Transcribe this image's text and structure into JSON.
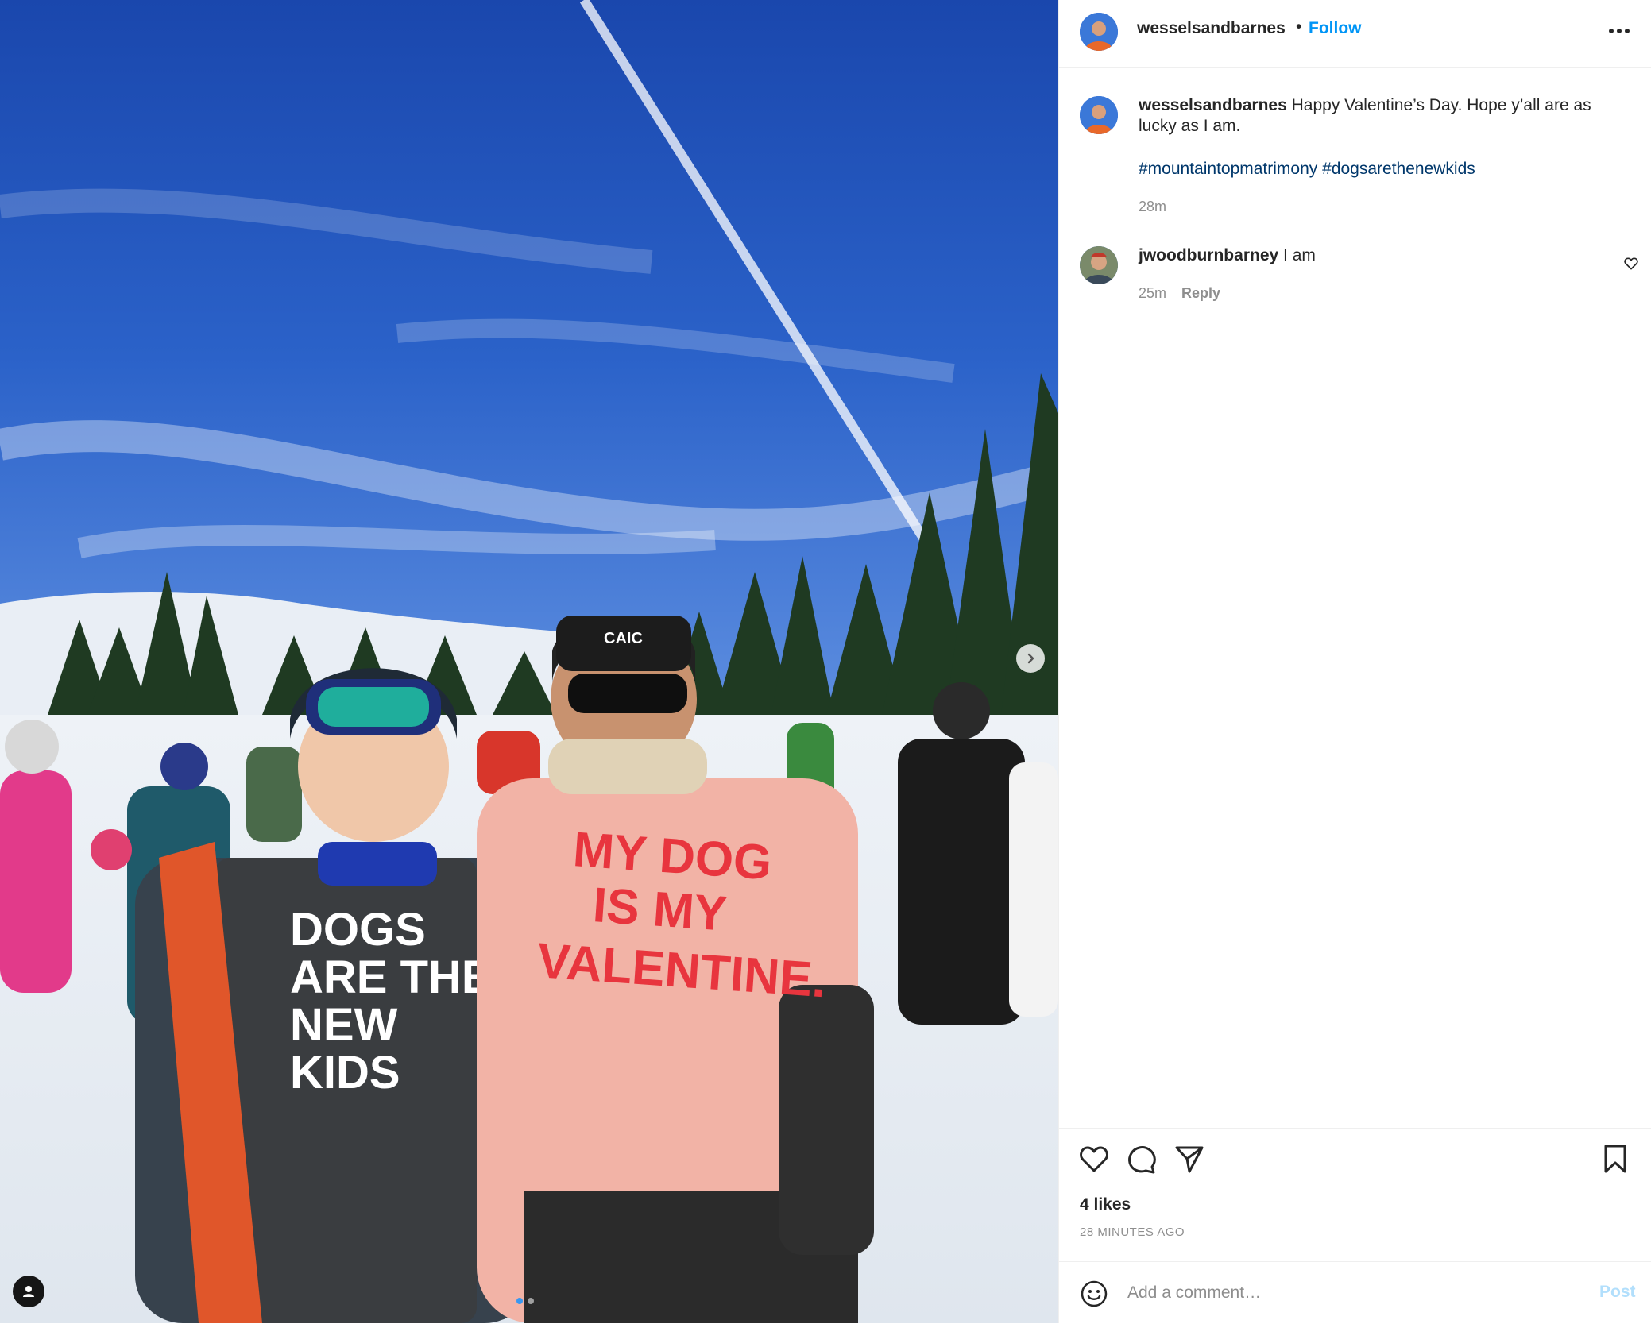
{
  "post": {
    "username": "wesselsandbarnes",
    "separator": "•",
    "follow_label": "Follow",
    "more_icon": "more-horizontal-icon"
  },
  "caption": {
    "username": "wesselsandbarnes",
    "text": "Happy Valentine’s Day. Hope y’all are as lucky as I am.",
    "hashtags": [
      "#mountaintopmatrimony",
      "#dogsarethenewkids"
    ],
    "time": "28m"
  },
  "comments": [
    {
      "username": "jwoodburnbarney",
      "text": "I am",
      "time": "25m",
      "reply_label": "Reply"
    }
  ],
  "actions": {
    "likes": "4 likes",
    "posted_ago": "28 MINUTES AGO"
  },
  "comment_form": {
    "placeholder": "Add a comment…",
    "post_label": "Post"
  },
  "photo": {
    "shirt_left": "DOGS ARE THE NEW KIDS",
    "shirt_right": "MY DOG IS MY VALENTINE.",
    "hat_logo": "CAIC",
    "carousel_dots": 2,
    "active_dot": 1
  },
  "colors": {
    "accent": "#0095f6",
    "hashtag": "#00376b",
    "muted": "#8e8e8e",
    "post_disabled": "#b2dffc"
  }
}
